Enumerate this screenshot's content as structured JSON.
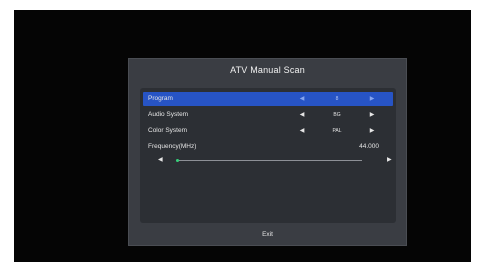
{
  "dialog": {
    "title": "ATV Manual Scan",
    "exit_label": "Exit"
  },
  "rows": [
    {
      "label": "Program",
      "value": "8",
      "selected": true
    },
    {
      "label": "Audio System",
      "value": "BG",
      "selected": false
    },
    {
      "label": "Color System",
      "value": "PAL",
      "selected": false
    }
  ],
  "frequency": {
    "label": "Frequency(MHz)",
    "value": "44.000",
    "slider_fraction": 0.0
  },
  "icons": {
    "left": "◀",
    "right": "▶"
  },
  "colors": {
    "selection": "#2754c5",
    "slider_thumb": "#34d17a"
  }
}
